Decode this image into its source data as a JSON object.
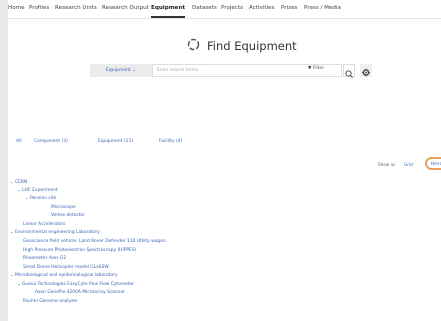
{
  "nav": {
    "items": [
      {
        "label": "Home"
      },
      {
        "label": "Profiles"
      },
      {
        "label": "Research Units"
      },
      {
        "label": "Research Output"
      },
      {
        "label": "Equipment",
        "active": true
      },
      {
        "label": "Datasets"
      },
      {
        "label": "Projects"
      },
      {
        "label": "Activities"
      },
      {
        "label": "Prizes"
      },
      {
        "label": "Press / Media"
      }
    ]
  },
  "header": {
    "title": "Find Equipment"
  },
  "search": {
    "type_select": "Equipment",
    "placeholder": "Enter search terms...",
    "filter_label": "Filter"
  },
  "tabs": [
    {
      "label": "All"
    },
    {
      "label": "Component (3)"
    },
    {
      "label": "Equipment (11)"
    },
    {
      "label": "Facility (4)"
    }
  ],
  "view": {
    "show_as_label": "Show as",
    "grid_label": "Grid",
    "hierarchy_label": "Hiera"
  },
  "tree": [
    {
      "label": "CERN",
      "caret": true
    },
    {
      "label": "LHC Experiment",
      "caret": true
    },
    {
      "label": "Pension site",
      "caret": true
    },
    {
      "label": "Microscope",
      "caret": false
    },
    {
      "label": "Vertex detector",
      "caret": false
    },
    {
      "label": "Linear Accelerators",
      "caret": false
    },
    {
      "label": "Environmental engineering Laboratory",
      "caret": true
    },
    {
      "label": "Geoscience field vehicle: Land Rover Defender 110 Utility wagon.",
      "caret": false
    },
    {
      "label": "High Pressure Photoelectron Spectroscopy (HiPPES)",
      "caret": false
    },
    {
      "label": "Rheometer Ares G2",
      "caret": false
    },
    {
      "label": "Small Drone Helicopter model GLaSSW.",
      "caret": false
    },
    {
      "label": "Microbiological and epidemiological laboratory",
      "caret": true
    },
    {
      "label": "Guava Technologies EasyCyte Plus Flow Cytometer",
      "caret": true
    },
    {
      "label": "Axon GenePix 4200A Microarray Scanner",
      "caret": false
    },
    {
      "label": "Illumni Genome analyzer",
      "caret": false
    }
  ],
  "colors": {
    "link": "#3a66b4",
    "accent": "#e8a15b"
  }
}
